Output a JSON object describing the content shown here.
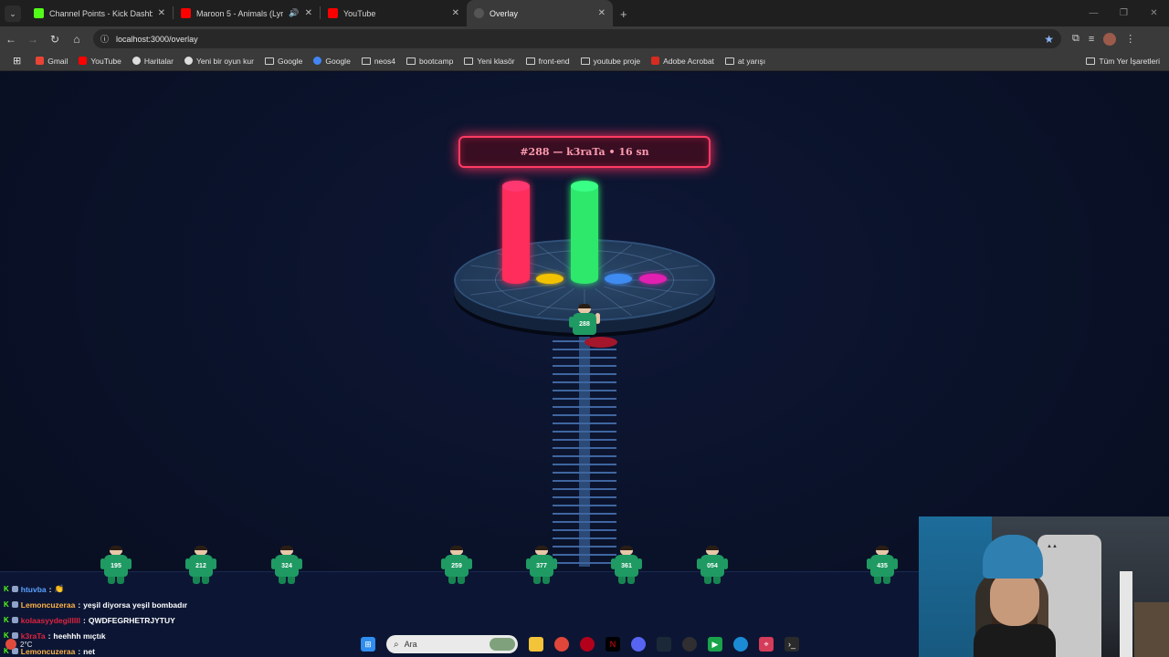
{
  "browser": {
    "tabs": [
      {
        "label": "Channel Points - Kick Dashboa",
        "icon": "kick-icon",
        "color": "#53fc18",
        "active": false
      },
      {
        "label": "Maroon 5 - Animals (Lyric V",
        "icon": "youtube-icon",
        "color": "#ff0000",
        "active": false
      },
      {
        "label": "YouTube",
        "icon": "youtube-icon",
        "color": "#ff0000",
        "active": false
      },
      {
        "label": "Overlay",
        "icon": "globe-icon",
        "color": "#777777",
        "active": true
      }
    ],
    "url": "localhost:3000/overlay",
    "bookmarks": [
      {
        "label": "Gmail",
        "icon": "gmail-icon",
        "color": "#ea4335"
      },
      {
        "label": "YouTube",
        "icon": "youtube-icon",
        "color": "#ff0000"
      },
      {
        "label": "Haritalar",
        "icon": "maps-icon",
        "color": "#dddddd"
      },
      {
        "label": "Yeni bir oyun kur",
        "icon": "game-icon",
        "color": "#dddddd"
      },
      {
        "label": "Google",
        "icon": "folder-icon",
        "color": ""
      },
      {
        "label": "Google",
        "icon": "google-icon",
        "color": "#4285f4"
      },
      {
        "label": "neos4",
        "icon": "folder-icon",
        "color": ""
      },
      {
        "label": "bootcamp",
        "icon": "folder-icon",
        "color": ""
      },
      {
        "label": "Yeni klasör",
        "icon": "folder-icon",
        "color": ""
      },
      {
        "label": "front-end",
        "icon": "folder-icon",
        "color": ""
      },
      {
        "label": "youtube proje",
        "icon": "folder-icon",
        "color": ""
      },
      {
        "label": "Adobe Acrobat",
        "icon": "acrobat-icon",
        "color": "#d62b1f"
      },
      {
        "label": "at yarışı",
        "icon": "folder-icon",
        "color": ""
      }
    ],
    "all_bookmarks": "Tüm Yer İşaretleri"
  },
  "overlay": {
    "banner": "#288 — k3raTa • 16 sn",
    "bars": [
      {
        "color": "#ff2d5b",
        "level": 0.75
      },
      {
        "color": "#2ee86b",
        "level": 0.75
      }
    ],
    "dots": [
      {
        "color": "#f2c200"
      },
      {
        "color": "#3e8cf2"
      },
      {
        "color": "#e11fb0"
      }
    ],
    "active_player": "288",
    "players": [
      "195",
      "212",
      "324",
      "259",
      "377",
      "361",
      "054",
      "435"
    ]
  },
  "chat": [
    {
      "user": "htuvba",
      "user_color": "#5aa0ff",
      "message": "👏"
    },
    {
      "user": "Lemoncuzeraa",
      "user_color": "#ffb347",
      "message": "yeşil diyorsa yeşil bombadır"
    },
    {
      "user": "kolaasyydegilllll",
      "user_color": "#e0233f",
      "message": "QWDFEGRHETRJYTUY"
    },
    {
      "user": "k3raTa",
      "user_color": "#e0233f",
      "message": "heehhh mıçtık"
    },
    {
      "user": "Lemoncuzeraa",
      "user_color": "#ffb347",
      "message": "net"
    }
  ],
  "taskbar": {
    "search_placeholder": "Ara",
    "temperature": "2°C"
  }
}
